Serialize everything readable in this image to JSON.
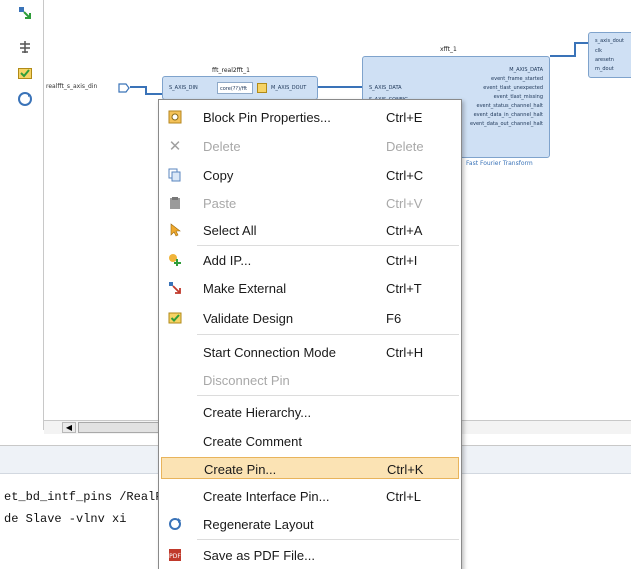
{
  "canvas": {
    "external_port_label": "realfft_s_axis_din",
    "blocks": {
      "realfft": {
        "title": "fft_real2fft_1",
        "left_pin": "S_AXIS_DIN",
        "right_pin": "M_AXIS_DOUT",
        "inner_box": "core(??)/fft"
      },
      "fft": {
        "title": "xfft_1",
        "left_pins": [
          "S_AXIS_DATA",
          "S_AXIS_CONFIG"
        ],
        "right_pins": [
          "M_AXIS_DATA",
          "event_frame_started",
          "event_tlast_unexpected",
          "event_tlast_missing",
          "event_status_channel_halt",
          "event_data_in_channel_halt",
          "event_data_out_channel_halt"
        ],
        "subtitle": "Fast Fourier Transform"
      },
      "right": {
        "pins": [
          "s_axis_dout",
          "clk",
          "aresetn",
          "m_dout"
        ]
      }
    }
  },
  "console": {
    "lines": [
      "et_bd_intf_pins /RealFFT/s_axis_d  bd_intf_pins /RealF",
      "de Slave -vlnv xi                  ealfft_s_axis_din'"
    ]
  },
  "menu": {
    "items": [
      {
        "label": "Block Pin Properties...",
        "shortcut": "Ctrl+E",
        "icon": "block-pin-properties-icon",
        "disabled": false
      },
      {
        "label": "Delete",
        "shortcut": "Delete",
        "icon": "delete-x-icon",
        "disabled": true
      },
      {
        "label": "Copy",
        "shortcut": "Ctrl+C",
        "icon": "copy-icon",
        "disabled": false
      },
      {
        "label": "Paste",
        "shortcut": "Ctrl+V",
        "icon": "paste-icon",
        "disabled": true
      },
      {
        "label": "Select All",
        "shortcut": "Ctrl+A",
        "icon": "select-all-icon",
        "disabled": false
      },
      {
        "label": "Add IP...",
        "shortcut": "Ctrl+I",
        "icon": "add-ip-icon",
        "disabled": false
      },
      {
        "label": "Make External",
        "shortcut": "Ctrl+T",
        "icon": "make-external-icon",
        "disabled": false
      },
      {
        "label": "Validate Design",
        "shortcut": "F6",
        "icon": "validate-design-icon",
        "disabled": false
      },
      {
        "label": "Start Connection Mode",
        "shortcut": "Ctrl+H",
        "icon": "",
        "disabled": false
      },
      {
        "label": "Disconnect Pin",
        "shortcut": "",
        "icon": "",
        "disabled": true
      },
      {
        "label": "Create Hierarchy...",
        "shortcut": "",
        "icon": "",
        "disabled": false
      },
      {
        "label": "Create Comment",
        "shortcut": "",
        "icon": "",
        "disabled": false
      },
      {
        "label": "Create Pin...",
        "shortcut": "Ctrl+K",
        "icon": "",
        "disabled": false,
        "highlighted": true
      },
      {
        "label": "Create Interface Pin...",
        "shortcut": "Ctrl+L",
        "icon": "",
        "disabled": false
      },
      {
        "label": "Regenerate Layout",
        "shortcut": "",
        "icon": "regenerate-layout-icon",
        "disabled": false
      },
      {
        "label": "Save as PDF File...",
        "shortcut": "",
        "icon": "pdf-icon",
        "disabled": false
      }
    ]
  },
  "colors": {
    "wire": "#3a73b8",
    "block_fill": "#cfe0f4",
    "highlight": "#fbe3b4",
    "highlight_border": "#e8b45c"
  }
}
